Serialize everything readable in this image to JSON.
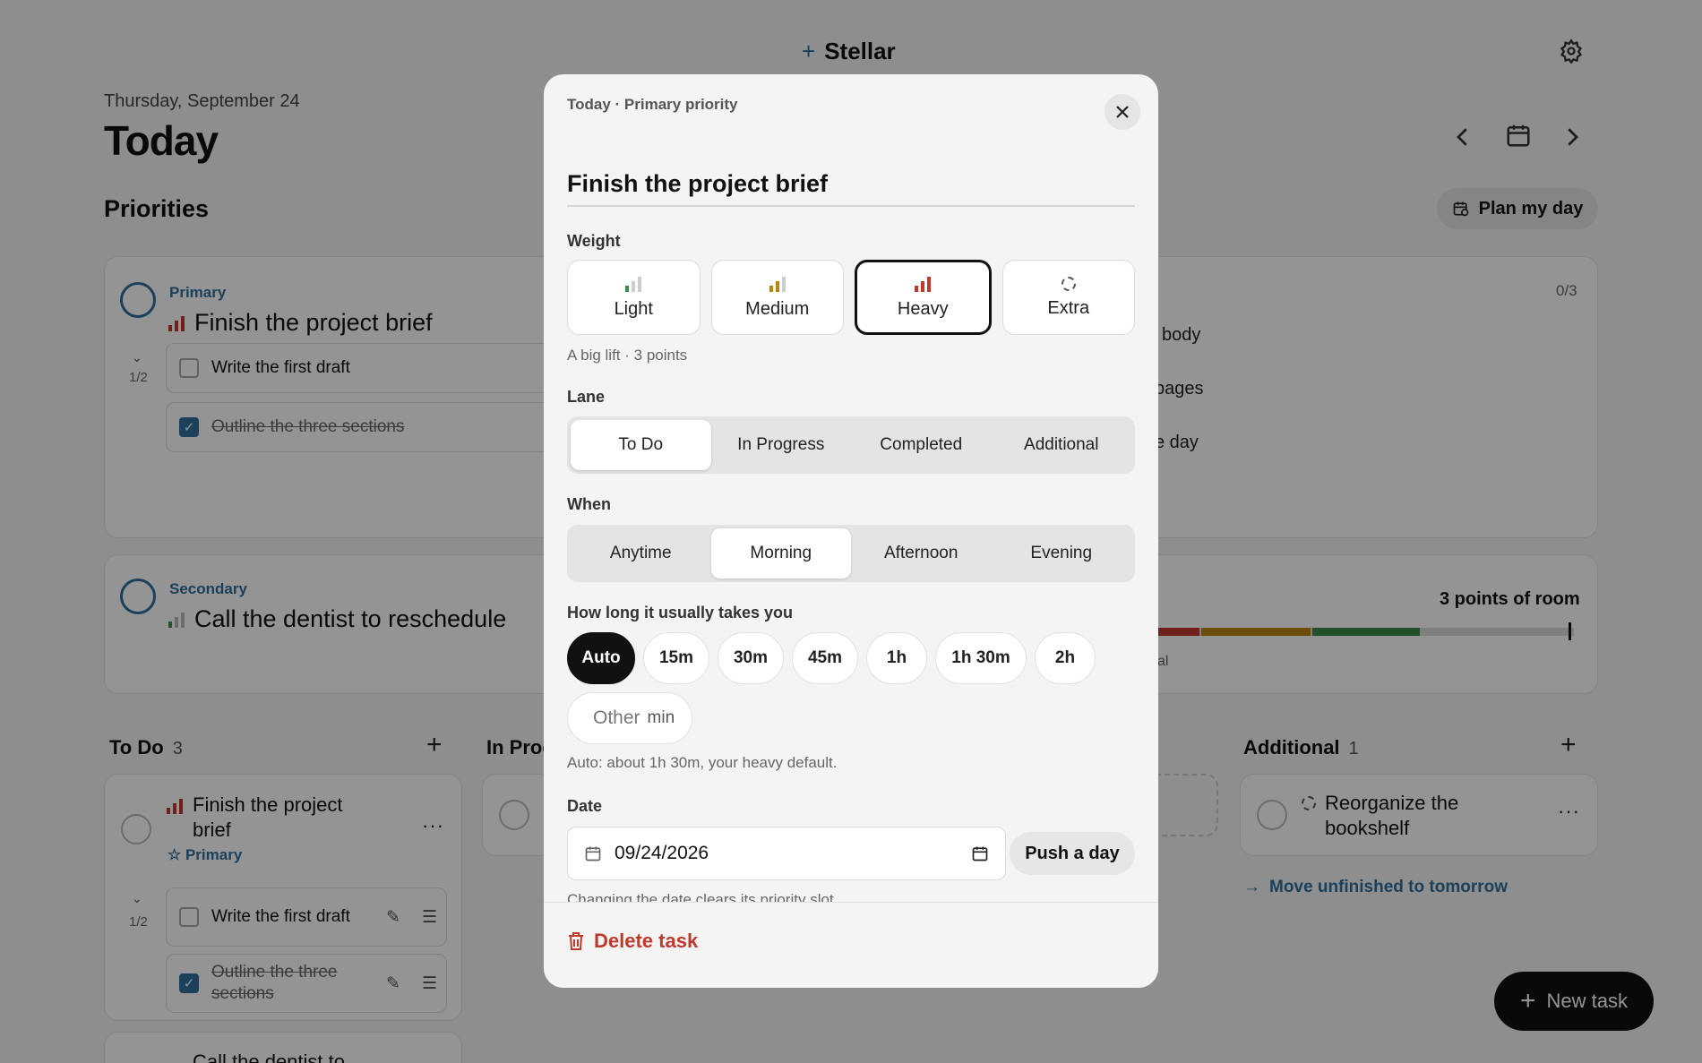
{
  "app": {
    "name": "Stellar",
    "date_line": "Thursday, September 24",
    "title": "Today",
    "priorities_heading": "Priorities",
    "plan_button": "Plan my day"
  },
  "primary_card": {
    "kicker": "Primary",
    "title": "Finish the project brief",
    "subtask_count": "1/2",
    "subtasks": [
      {
        "label": "Write the first draft",
        "done": false
      },
      {
        "label": "Outline the three sections",
        "done": true
      }
    ],
    "right_count": "0/3",
    "right_items": [
      "body",
      "pages",
      "e day"
    ]
  },
  "secondary_card": {
    "kicker": "Secondary",
    "title": "Call the dentist to reschedule",
    "room": "3 points of room",
    "bar_note": "al"
  },
  "columns": {
    "todo": {
      "title": "To Do",
      "count": "3",
      "card_title": "Finish the project brief",
      "card_tag": "Primary",
      "subtask_count": "1/2",
      "subtasks": [
        {
          "label": "Write the first draft",
          "done": false
        },
        {
          "label": "Outline the three sections",
          "done": true
        }
      ],
      "next_card_title": "Call the dentist to"
    },
    "inprogress": {
      "title": "In Prog"
    },
    "additional": {
      "title": "Additional",
      "count": "1",
      "card_title": "Reorganize the bookshelf",
      "move_link": "Move unfinished to tomorrow"
    }
  },
  "fab_label": "New task",
  "modal": {
    "kicker": "Today · Primary priority",
    "title_value": "Finish the project brief",
    "weight_label": "Weight",
    "weights": [
      {
        "label": "Light",
        "icon": "signal-1-icon",
        "selected": false
      },
      {
        "label": "Medium",
        "icon": "signal-2-icon",
        "selected": false
      },
      {
        "label": "Heavy",
        "icon": "signal-3-icon",
        "selected": true
      },
      {
        "label": "Extra",
        "icon": "dashed-circle-icon",
        "selected": false
      }
    ],
    "weight_hint": "A big lift · 3 points",
    "lane_label": "Lane",
    "lanes": [
      "To Do",
      "In Progress",
      "Completed",
      "Additional"
    ],
    "lane_selected": "To Do",
    "when_label": "When",
    "whens": [
      "Anytime",
      "Morning",
      "Afternoon",
      "Evening"
    ],
    "when_selected": "Morning",
    "duration_label": "How long it usually takes you",
    "durations": [
      "Auto",
      "15m",
      "30m",
      "45m",
      "1h",
      "1h 30m",
      "2h"
    ],
    "duration_selected": "Auto",
    "other_placeholder": "Other",
    "other_unit": "min",
    "duration_hint": "Auto: about 1h 30m, your heavy default.",
    "date_label": "Date",
    "date_value": "09/24/2026",
    "push_button": "Push a day",
    "date_hint": "Changing the date clears its priority slot.",
    "delete_button": "Delete task"
  },
  "colors": {
    "accent": "#2f6f9e",
    "heavy": "#c0392b",
    "medium": "#b8860b",
    "light": "#3d8a4a",
    "danger": "#c0392b"
  }
}
